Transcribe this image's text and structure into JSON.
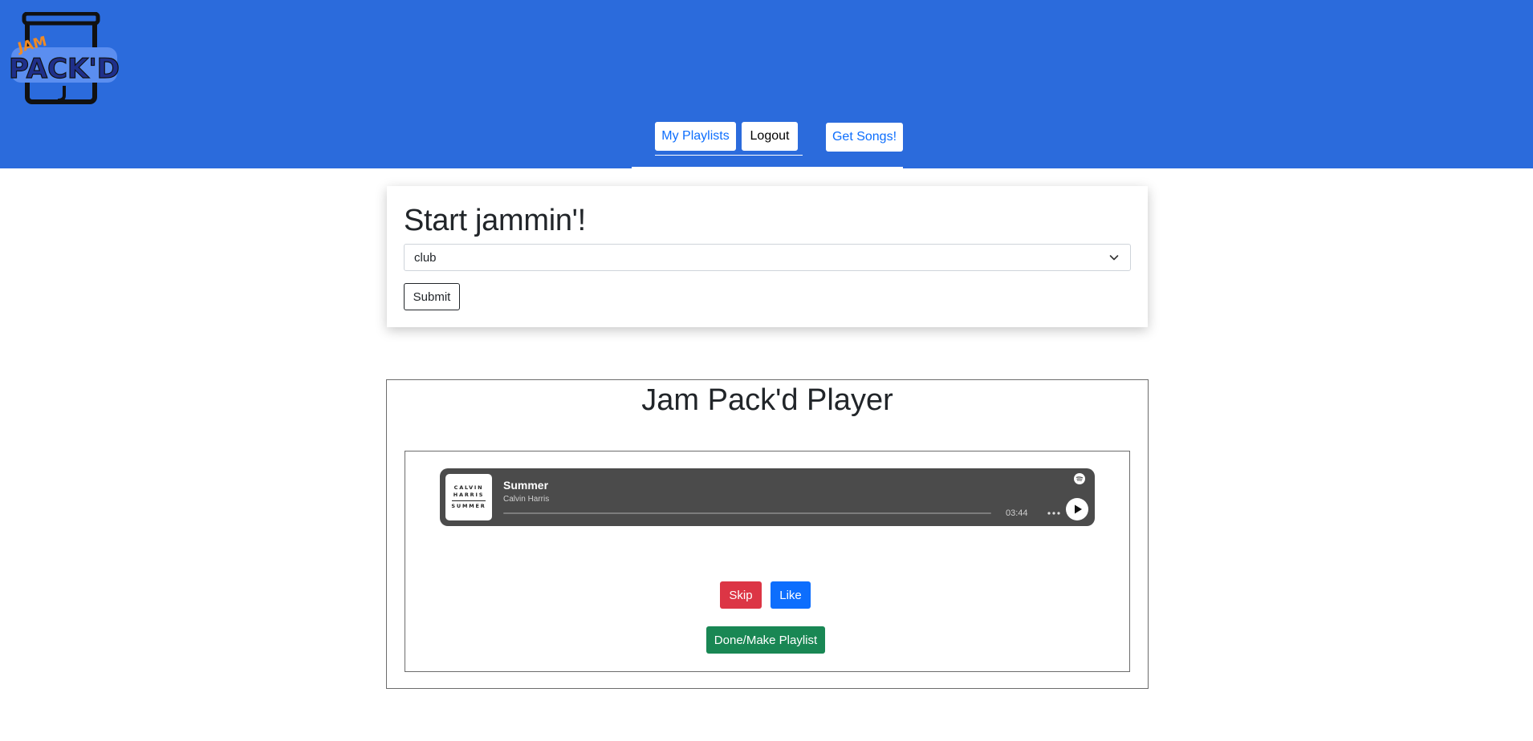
{
  "header": {
    "logo_text_top": "JAM",
    "logo_text_main": "PACK'D",
    "background_color": "#2b6bdc"
  },
  "nav": {
    "my_playlists_label": "My Playlists",
    "logout_label": "Logout",
    "get_songs_label": "Get Songs!"
  },
  "start": {
    "title": "Start jammin'!",
    "select_value": "club",
    "submit_label": "Submit"
  },
  "player": {
    "title": "Jam Pack'd Player",
    "embed": {
      "track_name": "Summer",
      "artist": "Calvin Harris",
      "duration": "03:44",
      "progress": 0,
      "cover_lines": [
        "CALVIN",
        "HARRIS",
        "SUMMER"
      ],
      "icons": [
        "more-icon",
        "play-icon",
        "spotify-icon"
      ]
    },
    "skip_label": "Skip",
    "like_label": "Like",
    "done_label": "Done/Make Playlist"
  },
  "colors": {
    "skip": "#dc3545",
    "like": "#0d6efd",
    "done": "#198754",
    "embed_bg": "#4b4b4b"
  }
}
